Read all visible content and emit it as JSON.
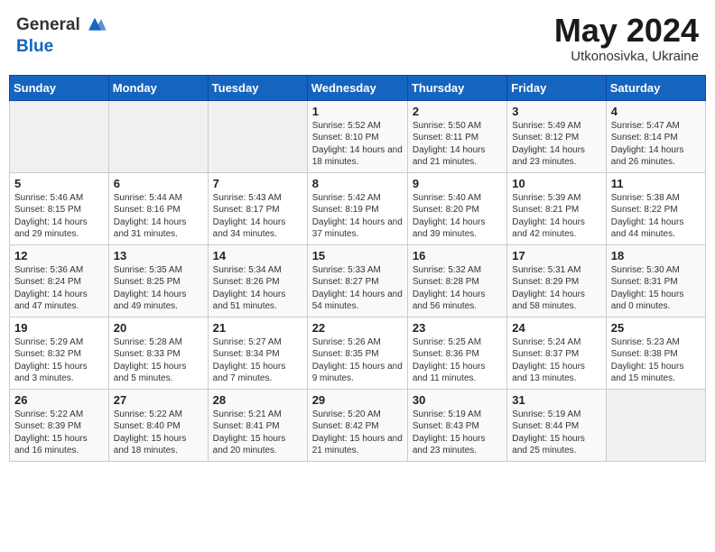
{
  "header": {
    "logo_line1": "General",
    "logo_line2": "Blue",
    "month": "May 2024",
    "location": "Utkonosivka, Ukraine"
  },
  "weekdays": [
    "Sunday",
    "Monday",
    "Tuesday",
    "Wednesday",
    "Thursday",
    "Friday",
    "Saturday"
  ],
  "weeks": [
    [
      {
        "day": "",
        "sunrise": "",
        "sunset": "",
        "daylight": ""
      },
      {
        "day": "",
        "sunrise": "",
        "sunset": "",
        "daylight": ""
      },
      {
        "day": "",
        "sunrise": "",
        "sunset": "",
        "daylight": ""
      },
      {
        "day": "1",
        "sunrise": "5:52 AM",
        "sunset": "8:10 PM",
        "daylight": "14 hours and 18 minutes."
      },
      {
        "day": "2",
        "sunrise": "5:50 AM",
        "sunset": "8:11 PM",
        "daylight": "14 hours and 21 minutes."
      },
      {
        "day": "3",
        "sunrise": "5:49 AM",
        "sunset": "8:12 PM",
        "daylight": "14 hours and 23 minutes."
      },
      {
        "day": "4",
        "sunrise": "5:47 AM",
        "sunset": "8:14 PM",
        "daylight": "14 hours and 26 minutes."
      }
    ],
    [
      {
        "day": "5",
        "sunrise": "5:46 AM",
        "sunset": "8:15 PM",
        "daylight": "14 hours and 29 minutes."
      },
      {
        "day": "6",
        "sunrise": "5:44 AM",
        "sunset": "8:16 PM",
        "daylight": "14 hours and 31 minutes."
      },
      {
        "day": "7",
        "sunrise": "5:43 AM",
        "sunset": "8:17 PM",
        "daylight": "14 hours and 34 minutes."
      },
      {
        "day": "8",
        "sunrise": "5:42 AM",
        "sunset": "8:19 PM",
        "daylight": "14 hours and 37 minutes."
      },
      {
        "day": "9",
        "sunrise": "5:40 AM",
        "sunset": "8:20 PM",
        "daylight": "14 hours and 39 minutes."
      },
      {
        "day": "10",
        "sunrise": "5:39 AM",
        "sunset": "8:21 PM",
        "daylight": "14 hours and 42 minutes."
      },
      {
        "day": "11",
        "sunrise": "5:38 AM",
        "sunset": "8:22 PM",
        "daylight": "14 hours and 44 minutes."
      }
    ],
    [
      {
        "day": "12",
        "sunrise": "5:36 AM",
        "sunset": "8:24 PM",
        "daylight": "14 hours and 47 minutes."
      },
      {
        "day": "13",
        "sunrise": "5:35 AM",
        "sunset": "8:25 PM",
        "daylight": "14 hours and 49 minutes."
      },
      {
        "day": "14",
        "sunrise": "5:34 AM",
        "sunset": "8:26 PM",
        "daylight": "14 hours and 51 minutes."
      },
      {
        "day": "15",
        "sunrise": "5:33 AM",
        "sunset": "8:27 PM",
        "daylight": "14 hours and 54 minutes."
      },
      {
        "day": "16",
        "sunrise": "5:32 AM",
        "sunset": "8:28 PM",
        "daylight": "14 hours and 56 minutes."
      },
      {
        "day": "17",
        "sunrise": "5:31 AM",
        "sunset": "8:29 PM",
        "daylight": "14 hours and 58 minutes."
      },
      {
        "day": "18",
        "sunrise": "5:30 AM",
        "sunset": "8:31 PM",
        "daylight": "15 hours and 0 minutes."
      }
    ],
    [
      {
        "day": "19",
        "sunrise": "5:29 AM",
        "sunset": "8:32 PM",
        "daylight": "15 hours and 3 minutes."
      },
      {
        "day": "20",
        "sunrise": "5:28 AM",
        "sunset": "8:33 PM",
        "daylight": "15 hours and 5 minutes."
      },
      {
        "day": "21",
        "sunrise": "5:27 AM",
        "sunset": "8:34 PM",
        "daylight": "15 hours and 7 minutes."
      },
      {
        "day": "22",
        "sunrise": "5:26 AM",
        "sunset": "8:35 PM",
        "daylight": "15 hours and 9 minutes."
      },
      {
        "day": "23",
        "sunrise": "5:25 AM",
        "sunset": "8:36 PM",
        "daylight": "15 hours and 11 minutes."
      },
      {
        "day": "24",
        "sunrise": "5:24 AM",
        "sunset": "8:37 PM",
        "daylight": "15 hours and 13 minutes."
      },
      {
        "day": "25",
        "sunrise": "5:23 AM",
        "sunset": "8:38 PM",
        "daylight": "15 hours and 15 minutes."
      }
    ],
    [
      {
        "day": "26",
        "sunrise": "5:22 AM",
        "sunset": "8:39 PM",
        "daylight": "15 hours and 16 minutes."
      },
      {
        "day": "27",
        "sunrise": "5:22 AM",
        "sunset": "8:40 PM",
        "daylight": "15 hours and 18 minutes."
      },
      {
        "day": "28",
        "sunrise": "5:21 AM",
        "sunset": "8:41 PM",
        "daylight": "15 hours and 20 minutes."
      },
      {
        "day": "29",
        "sunrise": "5:20 AM",
        "sunset": "8:42 PM",
        "daylight": "15 hours and 21 minutes."
      },
      {
        "day": "30",
        "sunrise": "5:19 AM",
        "sunset": "8:43 PM",
        "daylight": "15 hours and 23 minutes."
      },
      {
        "day": "31",
        "sunrise": "5:19 AM",
        "sunset": "8:44 PM",
        "daylight": "15 hours and 25 minutes."
      },
      {
        "day": "",
        "sunrise": "",
        "sunset": "",
        "daylight": ""
      }
    ]
  ]
}
